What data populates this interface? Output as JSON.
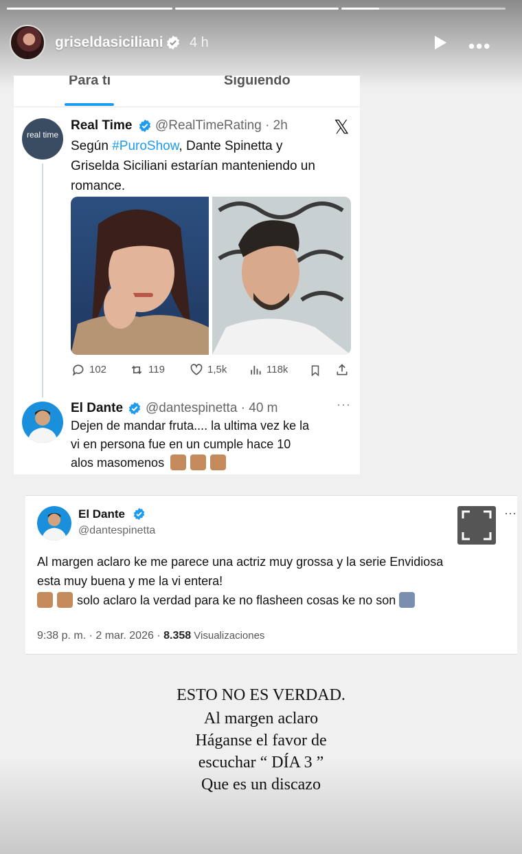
{
  "story": {
    "username": "griseldasiciliani",
    "time": "4 h",
    "progress_segments": 3,
    "active_segment": 3,
    "active_progress": 0.23
  },
  "tweet_screenshot": {
    "tabs": [
      "Para ti",
      "Siguiendo"
    ],
    "original": {
      "avatar_text": "real time",
      "name": "Real Time",
      "handle": "@RealTimeRating · 2h",
      "text_before": "Según ",
      "hashtag": "#PuroShow",
      "text_line1_after": ", Dante Spinetta y",
      "text_line2": "Griselda Siciliani estarían manteniendo un",
      "text_line3": "romance.",
      "metrics": {
        "replies": "102",
        "retweets": "119",
        "likes": "1,5k",
        "views": "118k"
      }
    },
    "reply": {
      "name": "El Dante",
      "handle": "@dantespinetta · 40 m",
      "line1": "Dejen de mandar fruta.... la ultima vez ke la",
      "line2": "vi en persona fue en un cumple hace 10",
      "line3": "alos masomenos"
    }
  },
  "tweet2": {
    "name": "El Dante",
    "handle": "@dantespinetta",
    "line1": "Al margen aclaro ke me parece una actriz muy grossa y la serie Envidiosa",
    "line2": "esta muy buena y me la vi entera!",
    "line3": "solo aclaro la verdad para ke no flasheen cosas ke no son",
    "meta_time": "9:38 p. m. · 2 mar. 2026 · ",
    "meta_views": "8.358",
    "meta_views_label": " Visualizaciones"
  },
  "caption": [
    "ESTO NO ES VERDAD.",
    "Al margen aclaro",
    "Háganse el favor de",
    "escuchar “ DÍA 3 ”",
    "Que es un discazo"
  ],
  "icons": [
    "verified-badge",
    "play-icon",
    "more-icon",
    "x-logo",
    "reply-icon",
    "retweet-icon",
    "like-icon",
    "views-icon",
    "bookmark-icon",
    "share-icon",
    "expand-icon"
  ],
  "colors": {
    "accent": "#1d9bf0",
    "verified": "#1d9bf0"
  }
}
